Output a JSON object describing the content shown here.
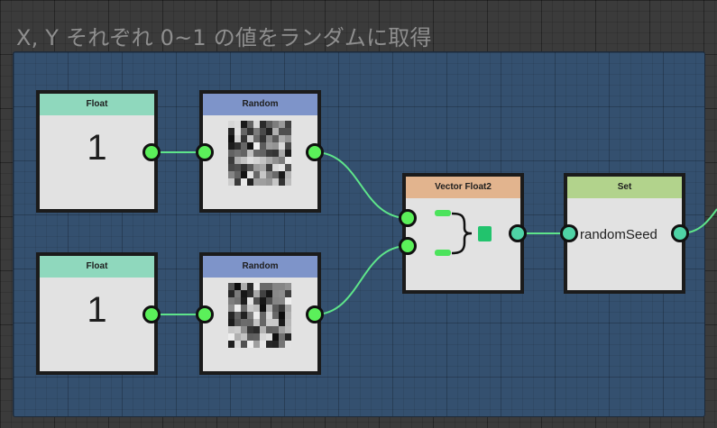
{
  "group": {
    "title": "X, Y それぞれ 0~1 の値をランダムに取得"
  },
  "nodes": {
    "float_1": {
      "header": "Float",
      "value": "1"
    },
    "float_2": {
      "header": "Float",
      "value": "1"
    },
    "random_1": {
      "header": "Random"
    },
    "random_2": {
      "header": "Random"
    },
    "vector": {
      "header": "Vector Float2"
    },
    "set": {
      "header": "Set",
      "variable": "randomSeed"
    }
  },
  "colors": {
    "group_bg": "#34506f",
    "float_header": "#8fd8bd",
    "random_header": "#7e94c9",
    "vector_header": "#e2b48e",
    "set_header": "#b2d38c",
    "port_float": "#5bf05a",
    "port_vector": "#4fd3a6",
    "wire": "#5ee48a"
  }
}
